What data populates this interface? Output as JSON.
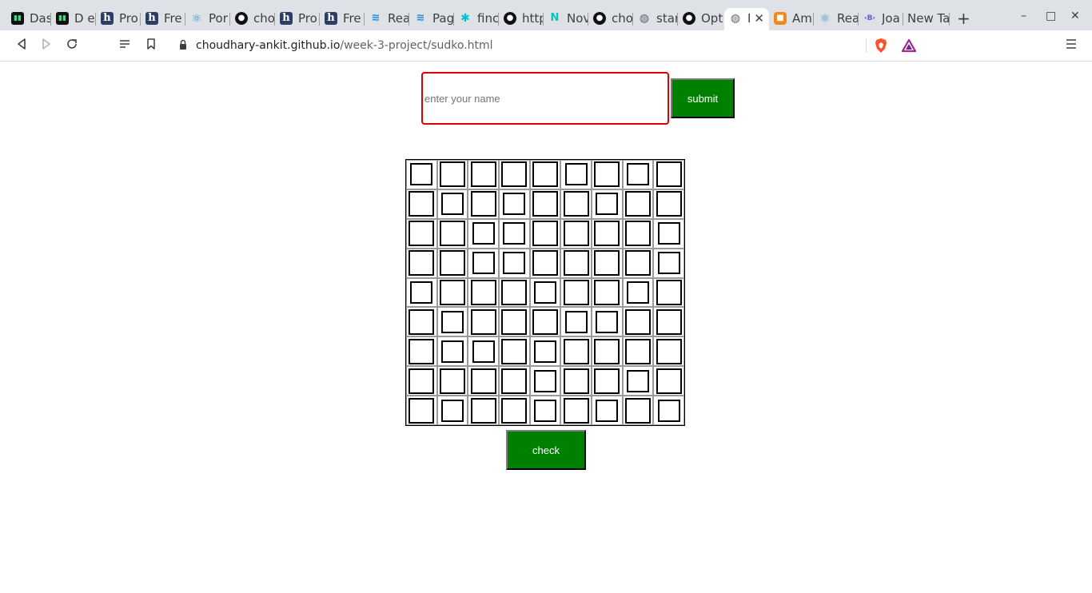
{
  "browser": {
    "tabs": [
      {
        "title": "Das",
        "icon": "devto-icon"
      },
      {
        "title": "D e",
        "icon": "devto-icon"
      },
      {
        "title": "Pro",
        "icon": "hashnode-icon"
      },
      {
        "title": "Fre",
        "icon": "hashnode-icon"
      },
      {
        "title": "Por",
        "icon": "react-icon"
      },
      {
        "title": "cho",
        "icon": "github-icon"
      },
      {
        "title": "Pro",
        "icon": "hashnode-icon"
      },
      {
        "title": "Fre",
        "icon": "hashnode-icon"
      },
      {
        "title": "Rea",
        "icon": "mui-icon"
      },
      {
        "title": "Pag",
        "icon": "mui-icon"
      },
      {
        "title": "finc",
        "icon": "x-logo-icon"
      },
      {
        "title": "http",
        "icon": "github-icon"
      },
      {
        "title": "Nov",
        "icon": "netlify-icon"
      },
      {
        "title": "cho",
        "icon": "github-icon"
      },
      {
        "title": "star",
        "icon": "globe-icon"
      },
      {
        "title": "Opt",
        "icon": "github-icon"
      },
      {
        "title": "I",
        "icon": "globe-icon",
        "active": true
      },
      {
        "title": "Am",
        "icon": "aws-icon"
      },
      {
        "title": "Rea",
        "icon": "react-icon"
      },
      {
        "title": "Joa",
        "icon": "bootstrap-icon"
      },
      {
        "title": "New Ta",
        "icon": ""
      }
    ],
    "new_tab_label": "+",
    "window_controls": {
      "minimize": "–",
      "maximize": "□",
      "close": "✕"
    },
    "url_host": "choudhary-ankit.github.io",
    "url_path": "/week-3-project/sudko.html",
    "accent": "#008000"
  },
  "page": {
    "name_placeholder": "enter your name",
    "name_value": "",
    "submit_label": "submit",
    "check_label": "check",
    "grid_rows": 9,
    "grid_cols": 9
  }
}
